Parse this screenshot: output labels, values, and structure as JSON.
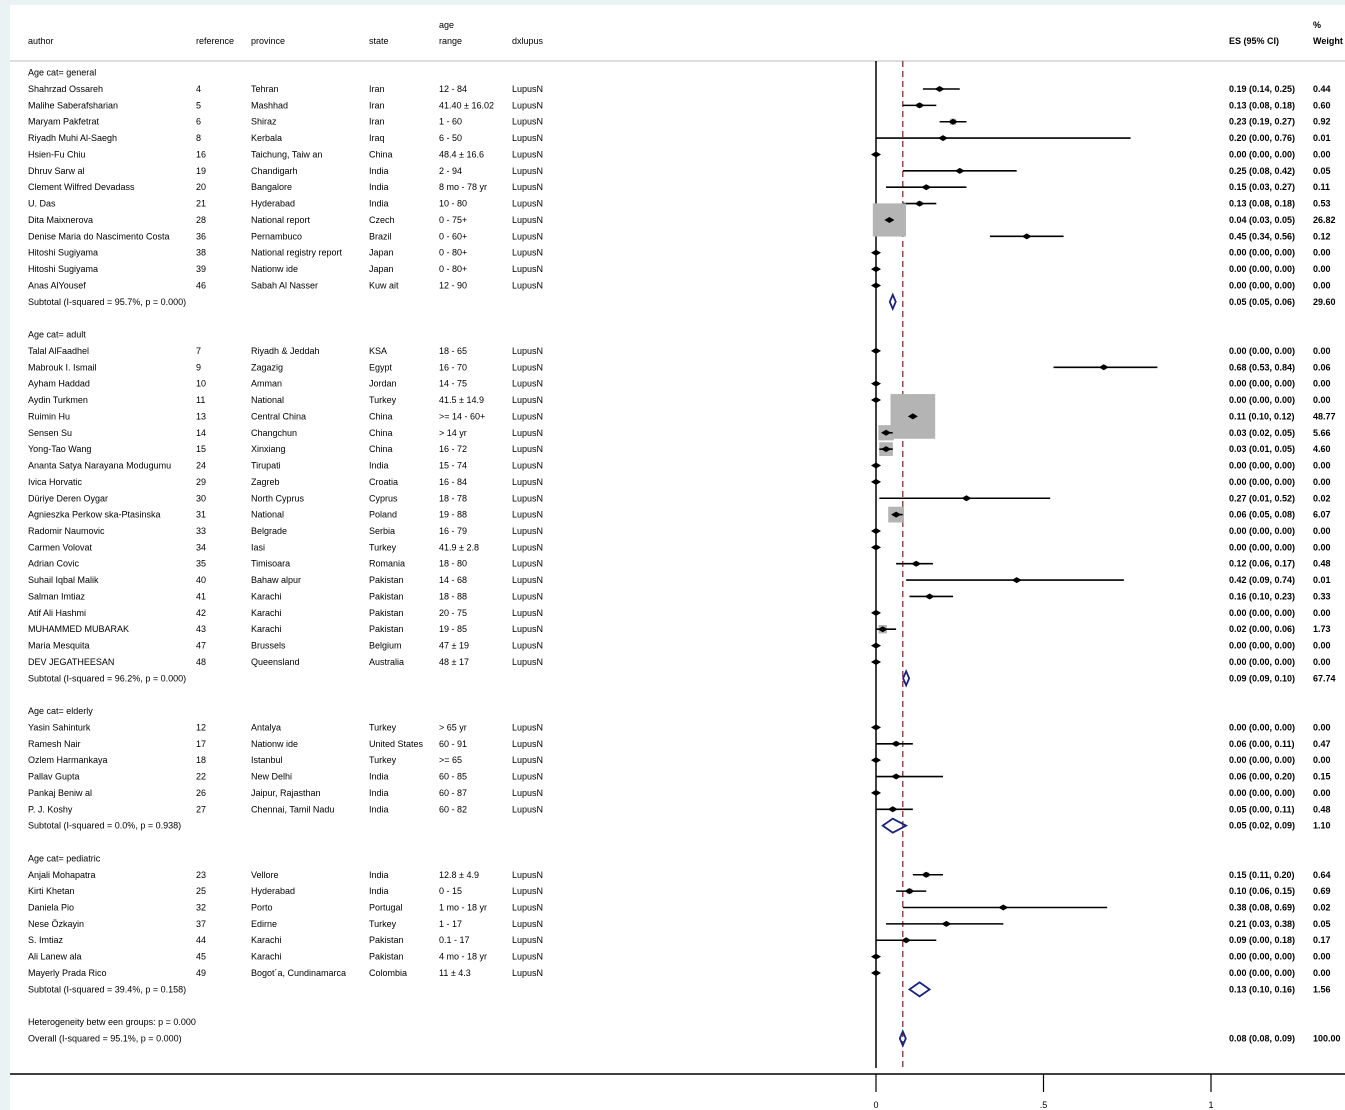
{
  "chart_data": {
    "type": "forest",
    "columns": {
      "author": "author",
      "reference": "reference",
      "province": "province",
      "state": "state",
      "age_range_top": "age",
      "age_range_bottom": "range",
      "dxlupus": "dxlupus",
      "es": "ES (95% CI)",
      "weight_top": "%",
      "weight_bottom": "Weight"
    },
    "x_axis": {
      "ticks": [
        0,
        0.5,
        1
      ],
      "tick_labels": [
        "0",
        ".5",
        "1"
      ],
      "range": [
        0,
        1
      ]
    },
    "overall_line": 0.08,
    "groups": [
      {
        "label": "Age cat= general",
        "studies": [
          {
            "author": "Shahrzad Ossareh",
            "reference": "4",
            "province": "Tehran",
            "state": "Iran",
            "age_range": "12 - 84",
            "dxlupus": "LupusN",
            "es": 0.19,
            "lo": 0.14,
            "hi": 0.25,
            "es_text": "0.19 (0.14, 0.25)",
            "weight": "0.44"
          },
          {
            "author": "Malihe Saberafsharian",
            "reference": "5",
            "province": "Mashhad",
            "state": "Iran",
            "age_range": "41.40 ± 16.02",
            "dxlupus": "LupusN",
            "es": 0.13,
            "lo": 0.08,
            "hi": 0.18,
            "es_text": "0.13 (0.08, 0.18)",
            "weight": "0.60"
          },
          {
            "author": "Maryam Pakfetrat",
            "reference": "6",
            "province": "Shiraz",
            "state": "Iran",
            "age_range": "1 - 60",
            "dxlupus": "LupusN",
            "es": 0.23,
            "lo": 0.19,
            "hi": 0.27,
            "es_text": "0.23 (0.19, 0.27)",
            "weight": "0.92"
          },
          {
            "author": "Riyadh Muhi Al-Saegh",
            "reference": "8",
            "province": "Kerbala",
            "state": "Iraq",
            "age_range": "6 - 50",
            "dxlupus": "LupusN",
            "es": 0.2,
            "lo": 0.0,
            "hi": 0.76,
            "es_text": "0.20 (0.00, 0.76)",
            "weight": "0.01"
          },
          {
            "author": "Hsien-Fu Chiu",
            "reference": "16",
            "province": "Taichung, Taiw an",
            "state": "China",
            "age_range": "48.4 ± 16.6",
            "dxlupus": "LupusN",
            "es": 0.0,
            "lo": 0.0,
            "hi": 0.0,
            "es_text": "0.00 (0.00, 0.00)",
            "weight": "0.00"
          },
          {
            "author": "Dhruv Sarw al",
            "reference": "19",
            "province": "Chandigarh",
            "state": "India",
            "age_range": "2 - 94",
            "dxlupus": "LupusN",
            "es": 0.25,
            "lo": 0.08,
            "hi": 0.42,
            "es_text": "0.25 (0.08, 0.42)",
            "weight": "0.05"
          },
          {
            "author": "Clement Wilfred Devadass",
            "reference": "20",
            "province": "Bangalore",
            "state": "India",
            "age_range": "8 mo - 78 yr",
            "dxlupus": "LupusN",
            "es": 0.15,
            "lo": 0.03,
            "hi": 0.27,
            "es_text": "0.15 (0.03, 0.27)",
            "weight": "0.11"
          },
          {
            "author": "U. Das",
            "reference": "21",
            "province": "Hyderabad",
            "state": "India",
            "age_range": "10 - 80",
            "dxlupus": "LupusN",
            "es": 0.13,
            "lo": 0.08,
            "hi": 0.18,
            "es_text": "0.13 (0.08, 0.18)",
            "weight": "0.53"
          },
          {
            "author": "Dita Maixnerova",
            "reference": "28",
            "province": "National report",
            "state": "Czech",
            "age_range": "0 - 75+",
            "dxlupus": "LupusN",
            "es": 0.04,
            "lo": 0.03,
            "hi": 0.05,
            "es_text": "0.04 (0.03, 0.05)",
            "weight": "26.82"
          },
          {
            "author": "Denise Maria do Nascimento Costa",
            "reference": "36",
            "province": "Pernambuco",
            "state": "Brazil",
            "age_range": "0 - 60+",
            "dxlupus": "LupusN",
            "es": 0.45,
            "lo": 0.34,
            "hi": 0.56,
            "es_text": "0.45 (0.34, 0.56)",
            "weight": "0.12"
          },
          {
            "author": "Hitoshi Sugiyama",
            "reference": "38",
            "province": "National registry report",
            "state": "Japan",
            "age_range": "0 - 80+",
            "dxlupus": "LupusN",
            "es": 0.0,
            "lo": 0.0,
            "hi": 0.0,
            "es_text": "0.00 (0.00, 0.00)",
            "weight": "0.00"
          },
          {
            "author": "Hitoshi Sugiyama",
            "reference": "39",
            "province": "Nationw ide",
            "state": "Japan",
            "age_range": "0 - 80+",
            "dxlupus": "LupusN",
            "es": 0.0,
            "lo": 0.0,
            "hi": 0.0,
            "es_text": "0.00 (0.00, 0.00)",
            "weight": "0.00"
          },
          {
            "author": "Anas AlYousef",
            "reference": "46",
            "province": "Sabah Al Nasser",
            "state": "Kuw ait",
            "age_range": "12 - 90",
            "dxlupus": "LupusN",
            "es": 0.0,
            "lo": 0.0,
            "hi": 0.0,
            "es_text": "0.00 (0.00, 0.00)",
            "weight": "0.00"
          }
        ],
        "subtotal": {
          "label": "Subtotal  (I-squared = 95.7%, p = 0.000)",
          "es": 0.05,
          "lo": 0.05,
          "hi": 0.06,
          "es_text": "0.05 (0.05, 0.06)",
          "weight": "29.60"
        }
      },
      {
        "label": "Age cat= adult",
        "studies": [
          {
            "author": "Talal AlFaadhel",
            "reference": "7",
            "province": "Riyadh & Jeddah",
            "state": "KSA",
            "age_range": "18 - 65",
            "dxlupus": "LupusN",
            "es": 0.0,
            "lo": 0.0,
            "hi": 0.0,
            "es_text": "0.00 (0.00, 0.00)",
            "weight": "0.00"
          },
          {
            "author": "Mabrouk I. Ismail",
            "reference": "9",
            "province": "Zagazig",
            "state": "Egypt",
            "age_range": "16 - 70",
            "dxlupus": "LupusN",
            "es": 0.68,
            "lo": 0.53,
            "hi": 0.84,
            "es_text": "0.68 (0.53, 0.84)",
            "weight": "0.06"
          },
          {
            "author": "Ayham Haddad",
            "reference": "10",
            "province": "Amman",
            "state": "Jordan",
            "age_range": "14 - 75",
            "dxlupus": "LupusN",
            "es": 0.0,
            "lo": 0.0,
            "hi": 0.0,
            "es_text": "0.00 (0.00, 0.00)",
            "weight": "0.00"
          },
          {
            "author": "Aydin Turkmen",
            "reference": "11",
            "province": "National",
            "state": "Turkey",
            "age_range": "41.5 ± 14.9",
            "dxlupus": "LupusN",
            "es": 0.0,
            "lo": 0.0,
            "hi": 0.0,
            "es_text": "0.00 (0.00, 0.00)",
            "weight": "0.00"
          },
          {
            "author": "Ruimin Hu",
            "reference": "13",
            "province": "Central China",
            "state": "China",
            "age_range": ">= 14 - 60+",
            "dxlupus": "LupusN",
            "es": 0.11,
            "lo": 0.1,
            "hi": 0.12,
            "es_text": "0.11 (0.10, 0.12)",
            "weight": "48.77"
          },
          {
            "author": "Sensen Su",
            "reference": "14",
            "province": "Changchun",
            "state": "China",
            "age_range": "> 14 yr",
            "dxlupus": "LupusN",
            "es": 0.03,
            "lo": 0.02,
            "hi": 0.05,
            "es_text": "0.03 (0.02, 0.05)",
            "weight": "5.66"
          },
          {
            "author": "Yong-Tao Wang",
            "reference": "15",
            "province": "Xinxiang",
            "state": "China",
            "age_range": "16 - 72",
            "dxlupus": "LupusN",
            "es": 0.03,
            "lo": 0.01,
            "hi": 0.05,
            "es_text": "0.03 (0.01, 0.05)",
            "weight": "4.60"
          },
          {
            "author": "Ananta Satya Narayana Modugumu",
            "reference": "24",
            "province": "Tirupati",
            "state": "India",
            "age_range": "15 - 74",
            "dxlupus": "LupusN",
            "es": 0.0,
            "lo": 0.0,
            "hi": 0.0,
            "es_text": "0.00 (0.00, 0.00)",
            "weight": "0.00"
          },
          {
            "author": "Ivica Horvatic",
            "reference": "29",
            "province": "Zagreb",
            "state": "Croatia",
            "age_range": "16 - 84",
            "dxlupus": "LupusN",
            "es": 0.0,
            "lo": 0.0,
            "hi": 0.0,
            "es_text": "0.00 (0.00, 0.00)",
            "weight": "0.00"
          },
          {
            "author": "Düriye Deren Oygar",
            "reference": "30",
            "province": "North Cyprus",
            "state": "Cyprus",
            "age_range": "18 - 78",
            "dxlupus": "LupusN",
            "es": 0.27,
            "lo": 0.01,
            "hi": 0.52,
            "es_text": "0.27 (0.01, 0.52)",
            "weight": "0.02"
          },
          {
            "author": "Agnieszka Perkow ska-Ptasinska",
            "reference": "31",
            "province": "National",
            "state": "Poland",
            "age_range": "19 - 88",
            "dxlupus": "LupusN",
            "es": 0.06,
            "lo": 0.05,
            "hi": 0.08,
            "es_text": "0.06 (0.05, 0.08)",
            "weight": "6.07"
          },
          {
            "author": "Radomir Naumovic",
            "reference": "33",
            "province": "Belgrade",
            "state": "Serbia",
            "age_range": "16 - 79",
            "dxlupus": "LupusN",
            "es": 0.0,
            "lo": 0.0,
            "hi": 0.0,
            "es_text": "0.00 (0.00, 0.00)",
            "weight": "0.00"
          },
          {
            "author": "Carmen Volovat",
            "reference": "34",
            "province": "Iasi",
            "state": "Turkey",
            "age_range": "41.9 ± 2.8",
            "dxlupus": "LupusN",
            "es": 0.0,
            "lo": 0.0,
            "hi": 0.0,
            "es_text": "0.00 (0.00, 0.00)",
            "weight": "0.00"
          },
          {
            "author": "Adrian Covic",
            "reference": "35",
            "province": "Timisoara",
            "state": "Romania",
            "age_range": "18 - 80",
            "dxlupus": "LupusN",
            "es": 0.12,
            "lo": 0.06,
            "hi": 0.17,
            "es_text": "0.12 (0.06, 0.17)",
            "weight": "0.48"
          },
          {
            "author": "Suhail Iqbal Malik",
            "reference": "40",
            "province": "Bahaw alpur",
            "state": "Pakistan",
            "age_range": "14 - 68",
            "dxlupus": "LupusN",
            "es": 0.42,
            "lo": 0.09,
            "hi": 0.74,
            "es_text": "0.42 (0.09, 0.74)",
            "weight": "0.01"
          },
          {
            "author": "Salman Imtiaz",
            "reference": "41",
            "province": "Karachi",
            "state": "Pakistan",
            "age_range": "18 - 88",
            "dxlupus": "LupusN",
            "es": 0.16,
            "lo": 0.1,
            "hi": 0.23,
            "es_text": "0.16 (0.10, 0.23)",
            "weight": "0.33"
          },
          {
            "author": "Atif Ali Hashmi",
            "reference": "42",
            "province": "Karachi",
            "state": "Pakistan",
            "age_range": "20 - 75",
            "dxlupus": "LupusN",
            "es": 0.0,
            "lo": 0.0,
            "hi": 0.0,
            "es_text": "0.00 (0.00, 0.00)",
            "weight": "0.00"
          },
          {
            "author": "MUHAMMED MUBARAK",
            "reference": "43",
            "province": "Karachi",
            "state": "Pakistan",
            "age_range": "19 - 85",
            "dxlupus": "LupusN",
            "es": 0.02,
            "lo": 0.0,
            "hi": 0.06,
            "es_text": "0.02 (0.00, 0.06)",
            "weight": "1.73"
          },
          {
            "author": "Maria Mesquita",
            "reference": "47",
            "province": "Brussels",
            "state": "Belgium",
            "age_range": "47 ± 19",
            "dxlupus": "LupusN",
            "es": 0.0,
            "lo": 0.0,
            "hi": 0.0,
            "es_text": "0.00 (0.00, 0.00)",
            "weight": "0.00"
          },
          {
            "author": "DEV JEGATHEESAN",
            "reference": "48",
            "province": "Queensland",
            "state": "Australia",
            "age_range": "48 ± 17",
            "dxlupus": "LupusN",
            "es": 0.0,
            "lo": 0.0,
            "hi": 0.0,
            "es_text": "0.00 (0.00, 0.00)",
            "weight": "0.00"
          }
        ],
        "subtotal": {
          "label": "Subtotal  (I-squared = 96.2%, p = 0.000)",
          "es": 0.09,
          "lo": 0.09,
          "hi": 0.1,
          "es_text": "0.09 (0.09, 0.10)",
          "weight": "67.74"
        }
      },
      {
        "label": "Age cat= elderly",
        "studies": [
          {
            "author": "Yasin Sahinturk",
            "reference": "12",
            "province": "Antalya",
            "state": "Turkey",
            "age_range": "> 65 yr",
            "dxlupus": "LupusN",
            "es": 0.0,
            "lo": 0.0,
            "hi": 0.0,
            "es_text": "0.00 (0.00, 0.00)",
            "weight": "0.00"
          },
          {
            "author": "Ramesh Nair",
            "reference": "17",
            "province": "Nationw ide",
            "state": "United States",
            "age_range": "60 - 91",
            "dxlupus": "LupusN",
            "es": 0.06,
            "lo": 0.0,
            "hi": 0.11,
            "es_text": "0.06 (0.00, 0.11)",
            "weight": "0.47"
          },
          {
            "author": "Ozlem Harmankaya",
            "reference": "18",
            "province": "Istanbul",
            "state": "Turkey",
            "age_range": ">= 65",
            "dxlupus": "LupusN",
            "es": 0.0,
            "lo": 0.0,
            "hi": 0.0,
            "es_text": "0.00 (0.00, 0.00)",
            "weight": "0.00"
          },
          {
            "author": "Pallav Gupta",
            "reference": "22",
            "province": "New  Delhi",
            "state": "India",
            "age_range": "60 - 85",
            "dxlupus": "LupusN",
            "es": 0.06,
            "lo": 0.0,
            "hi": 0.2,
            "es_text": "0.06 (0.00, 0.20)",
            "weight": "0.15"
          },
          {
            "author": "Pankaj Beniw al",
            "reference": "26",
            "province": "Jaipur, Rajasthan",
            "state": "India",
            "age_range": "60 - 87",
            "dxlupus": "LupusN",
            "es": 0.0,
            "lo": 0.0,
            "hi": 0.0,
            "es_text": "0.00 (0.00, 0.00)",
            "weight": "0.00"
          },
          {
            "author": "P. J. Koshy",
            "reference": "27",
            "province": "Chennai, Tamil Nadu",
            "state": "India",
            "age_range": "60 - 82",
            "dxlupus": "LupusN",
            "es": 0.05,
            "lo": 0.0,
            "hi": 0.11,
            "es_text": "0.05 (0.00, 0.11)",
            "weight": "0.48"
          }
        ],
        "subtotal": {
          "label": "Subtotal  (I-squared = 0.0%, p = 0.938)",
          "es": 0.05,
          "lo": 0.02,
          "hi": 0.09,
          "es_text": "0.05 (0.02, 0.09)",
          "weight": "1.10"
        }
      },
      {
        "label": "Age cat= pediatric",
        "studies": [
          {
            "author": "Anjali Mohapatra",
            "reference": "23",
            "province": "Vellore",
            "state": "India",
            "age_range": "12.8 ± 4.9",
            "dxlupus": "LupusN",
            "es": 0.15,
            "lo": 0.11,
            "hi": 0.2,
            "es_text": "0.15 (0.11, 0.20)",
            "weight": "0.64"
          },
          {
            "author": "Kirti Khetan",
            "reference": "25",
            "province": "Hyderabad",
            "state": "India",
            "age_range": "0 - 15",
            "dxlupus": "LupusN",
            "es": 0.1,
            "lo": 0.06,
            "hi": 0.15,
            "es_text": "0.10 (0.06, 0.15)",
            "weight": "0.69"
          },
          {
            "author": "Daniela Pio",
            "reference": "32",
            "province": "Porto",
            "state": "Portugal",
            "age_range": "1 mo - 18 yr",
            "dxlupus": "LupusN",
            "es": 0.38,
            "lo": 0.08,
            "hi": 0.69,
            "es_text": "0.38 (0.08, 0.69)",
            "weight": "0.02"
          },
          {
            "author": "Nese Özkayin",
            "reference": "37",
            "province": "Edirne",
            "state": "Turkey",
            "age_range": "1 - 17",
            "dxlupus": "LupusN",
            "es": 0.21,
            "lo": 0.03,
            "hi": 0.38,
            "es_text": "0.21 (0.03, 0.38)",
            "weight": "0.05"
          },
          {
            "author": "S. Imtiaz",
            "reference": "44",
            "province": "Karachi",
            "state": "Pakistan",
            "age_range": "0.1 - 17",
            "dxlupus": "LupusN",
            "es": 0.09,
            "lo": 0.0,
            "hi": 0.18,
            "es_text": "0.09 (0.00, 0.18)",
            "weight": "0.17"
          },
          {
            "author": "Ali Lanew ala",
            "reference": "45",
            "province": "Karachi",
            "state": "Pakistan",
            "age_range": "4 mo - 18 yr",
            "dxlupus": "LupusN",
            "es": 0.0,
            "lo": 0.0,
            "hi": 0.0,
            "es_text": "0.00 (0.00, 0.00)",
            "weight": "0.00"
          },
          {
            "author": "Mayerly Prada Rico",
            "reference": "49",
            "province": "Bogot´a, Cundinamarca",
            "state": "Colombia",
            "age_range": "11 ± 4.3",
            "dxlupus": "LupusN",
            "es": 0.0,
            "lo": 0.0,
            "hi": 0.0,
            "es_text": "0.00 (0.00, 0.00)",
            "weight": "0.00"
          }
        ],
        "subtotal": {
          "label": "Subtotal  (I-squared = 39.4%, p = 0.158)",
          "es": 0.13,
          "lo": 0.1,
          "hi": 0.16,
          "es_text": "0.13 (0.10, 0.16)",
          "weight": "1.56"
        }
      }
    ],
    "heterogeneity": "Heterogeneity betw een groups: p = 0.000",
    "overall": {
      "label": "Overall  (I-squared = 95.1%, p = 0.000)",
      "es": 0.08,
      "lo": 0.08,
      "hi": 0.09,
      "es_text": "0.08 (0.08, 0.09)",
      "weight": "100.00"
    }
  }
}
